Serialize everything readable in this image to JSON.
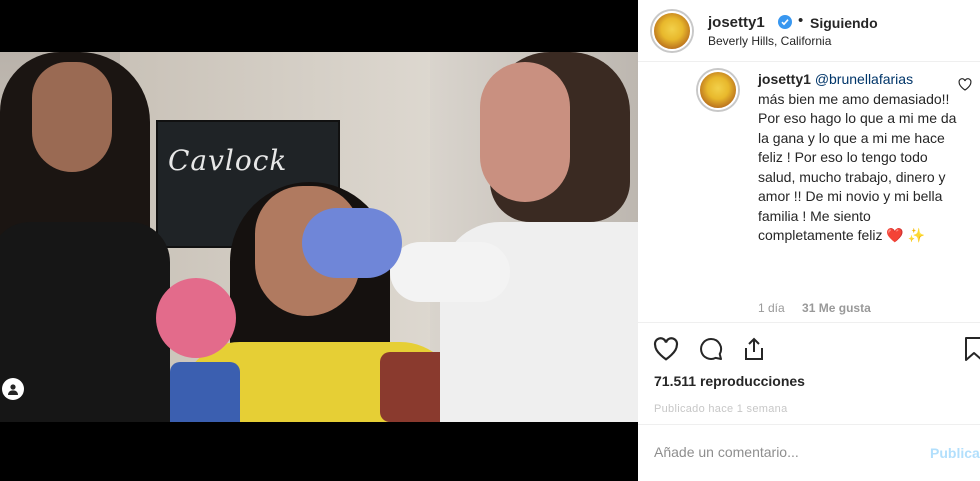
{
  "video": {
    "sign_text": "Cavlock",
    "icon": "user-tag-icon"
  },
  "header": {
    "username": "josetty1",
    "verified_icon": "verified-badge-icon",
    "separator": "•",
    "follow_status": "Siguiendo",
    "location": "Beverly Hills, California"
  },
  "comment": {
    "username": "josetty1",
    "mention": "@brunellafarias",
    "text": "más bien me amo demasiado!! Por eso hago lo que a mi me da la gana y lo que a mi me hace feliz ! Por eso lo tengo todo salud, mucho trabajo, dinero y amor !! De mi novio y mi bella familia ! Me siento completamente feliz",
    "emoji": "❤️ ✨",
    "age": "1 día",
    "likes": "31 Me gusta",
    "like_icon": "heart-outline-icon"
  },
  "actions": {
    "like_icon": "heart-icon",
    "comment_icon": "comment-bubble-icon",
    "share_icon": "share-icon",
    "save_icon": "bookmark-icon",
    "views": "71.511 reproducciones",
    "faded_line": "Publicado hace 1 semana"
  },
  "add_comment": {
    "placeholder": "Añade un comentario...",
    "publish_label": "Publicar"
  },
  "colors": {
    "accent": "#3897f0",
    "publish_disabled": "#b2dffc",
    "text": "#262626",
    "muted": "#999999"
  }
}
